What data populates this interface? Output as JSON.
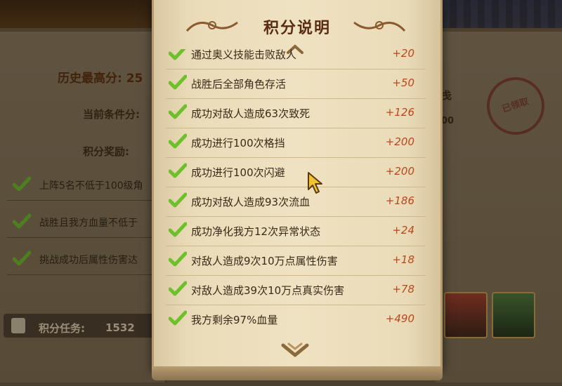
{
  "modal": {
    "title": "积分说明",
    "rows": [
      {
        "label": "通过奥义技能击败敌人",
        "score": "+20"
      },
      {
        "label": "战胜后全部角色存活",
        "score": "+50"
      },
      {
        "label": "成功对敌人造成63次致死",
        "score": "+126"
      },
      {
        "label": "成功进行100次格挡",
        "score": "+200"
      },
      {
        "label": "成功进行100次闪避",
        "score": "+200"
      },
      {
        "label": "成功对敌人造成93次流血",
        "score": "+186"
      },
      {
        "label": "成功净化我方12次异常状态",
        "score": "+24"
      },
      {
        "label": "对敌人造成9次10万点属性伤害",
        "score": "+18"
      },
      {
        "label": "对敌人造成39次10万点真实伤害",
        "score": "+78"
      },
      {
        "label": "我方剩余97%血量",
        "score": "+490"
      }
    ]
  },
  "background": {
    "history_best": "历史最高分: 25",
    "current_condition": "当前条件分:",
    "reward_label": "积分奖励:",
    "conditions": [
      "上阵5名不低于100级角",
      "战胜且我方血量不低于",
      "挑战成功后属性伤害达"
    ],
    "task_label": "积分任务:",
    "task_value": "1532",
    "stamp_text": "已领取",
    "side_char": "戋",
    "side_value": "00"
  },
  "colors": {
    "check_green": "#6cc12a",
    "score_orange": "#b8471c",
    "title_brown": "#5a2d12",
    "parchment": "#efe2c2"
  }
}
